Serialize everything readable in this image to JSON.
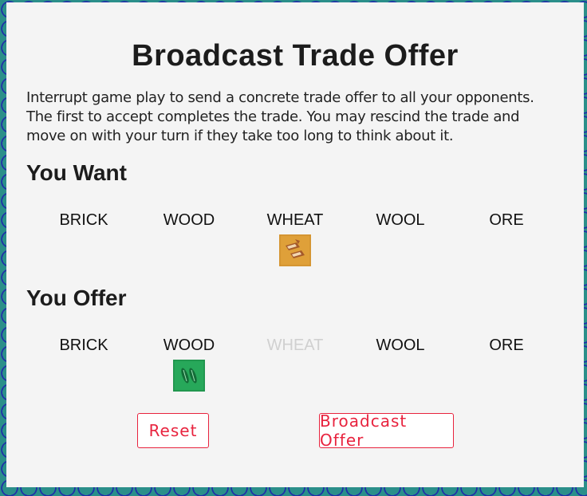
{
  "dialog": {
    "title": "Broadcast Trade Offer",
    "description": "Interrupt game play to send a concrete trade offer to all your opponents. The first to accept completes the trade. You may rescind the trade and move on with your turn if they take too long to think about it."
  },
  "want": {
    "title": "You Want",
    "resources": [
      {
        "label": "BRICK",
        "selected": false
      },
      {
        "label": "WOOD",
        "selected": false
      },
      {
        "label": "WHEAT",
        "selected": true
      },
      {
        "label": "WOOL",
        "selected": false
      },
      {
        "label": "ORE",
        "selected": false
      }
    ]
  },
  "offer": {
    "title": "You Offer",
    "resources": [
      {
        "label": "BRICK",
        "selected": false
      },
      {
        "label": "WOOD",
        "selected": true
      },
      {
        "label": "WHEAT",
        "selected": false,
        "disabled": true
      },
      {
        "label": "WOOL",
        "selected": false
      },
      {
        "label": "ORE",
        "selected": false
      }
    ]
  },
  "buttons": {
    "reset": "Reset",
    "broadcast": "Broadcast Offer"
  },
  "colors": {
    "accent": "#e8233e",
    "wheat_card": "#e3a33c",
    "wood_card": "#24a055",
    "dialog_bg": "#f4f4f4",
    "background": "#2b8f8a"
  }
}
